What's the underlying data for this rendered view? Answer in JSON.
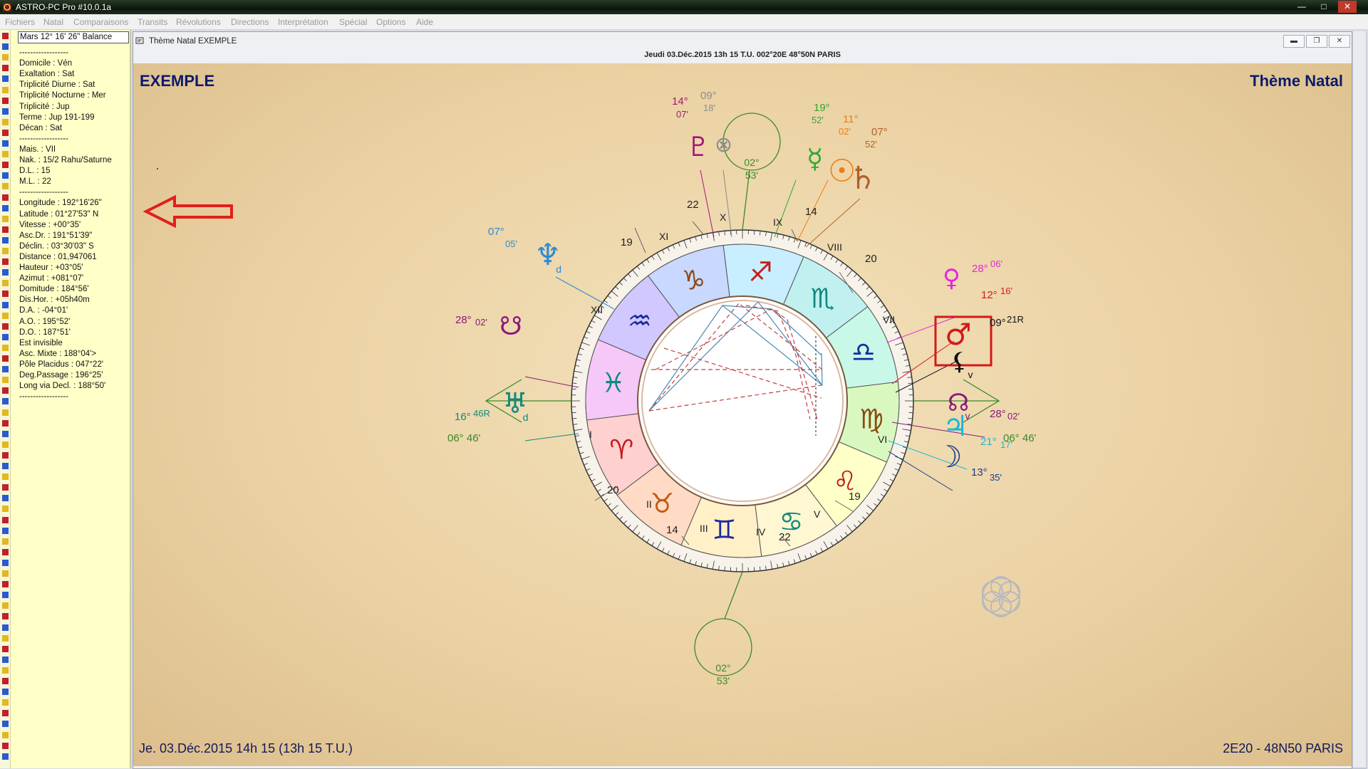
{
  "window": {
    "title": "ASTRO-PC Pro #10.0.1a"
  },
  "menu": [
    "Fichiers",
    "Natal",
    "Comparaisons",
    "Transits",
    "Révolutions",
    "Directions",
    "Interprétation",
    "Spécial",
    "Options",
    "Aide"
  ],
  "left_panel": {
    "headline": "Mars 12° 16' 26\" Balance",
    "lines": [
      "------------------",
      "Domicile : Vén",
      "Exaltation : Sat",
      "Triplicité Diurne : Sat",
      "Triplicité Nocturne : Mer",
      "Triplicité : Jup",
      "Terme : Jup 191-199",
      "Décan : Sat",
      "------------------",
      "Mais. : VII",
      "Nak. : 15/2  Rahu/Saturne",
      "D.L. : 15",
      "M.L. : 22",
      "------------------",
      "Longitude : 192°16'26\"",
      "Latitude : 01°27'53\" N",
      "Vitesse : +00°35'",
      "Asc.Dr. : 191°51'39\"",
      "Déclin. : 03°30'03\" S",
      "Distance : 01,947061",
      "Hauteur : +03°05'",
      "Azimut : +081°07'",
      "Domitude : 184°56'",
      "Dis.Hor. : +05h40m",
      "D.A. : -04°01'",
      "A.O. : 195°52'",
      "D.O. : 187°51'",
      "Est invisible",
      "Asc. Mixte : 188°04'>",
      "Pôle Placidus : 047°22'",
      "Deg.Passage : 196°25'",
      "Long via Decl. : 188°50'",
      "------------------"
    ]
  },
  "child_window": {
    "title": "Thème Natal  EXEMPLE",
    "info": "Jeudi 03.Déc.2015 13h 15 T.U. 002°20E 48°50N  PARIS",
    "buttons": [
      "minimize",
      "restore",
      "close"
    ]
  },
  "chart": {
    "name": "EXEMPLE",
    "kind": "Thème Natal",
    "footer_left": "Je. 03.Déc.2015 14h 15 (13h 15 T.U.)",
    "footer_right": "2E20 - 48N50  PARIS",
    "houses": [
      "I",
      "II",
      "III",
      "IV",
      "V",
      "VI",
      "VII",
      "VIII",
      "IX",
      "X",
      "XI",
      "XII"
    ],
    "signs": [
      {
        "glyph": "♈",
        "color": "#c41a1a",
        "bg": "#ffd0d0"
      },
      {
        "glyph": "♉",
        "color": "#c35a12",
        "bg": "#ffdac4"
      },
      {
        "glyph": "♊",
        "color": "#1a2a9c",
        "bg": "#fff0c8"
      },
      {
        "glyph": "♋",
        "color": "#0e8a7e",
        "bg": "#fff6d2"
      },
      {
        "glyph": "♌",
        "color": "#c41a1a",
        "bg": "#ffffc8"
      },
      {
        "glyph": "♍",
        "color": "#8a4a12",
        "bg": "#d8f8c0"
      },
      {
        "glyph": "♎",
        "color": "#1a2a9c",
        "bg": "#c8f8e8"
      },
      {
        "glyph": "♏",
        "color": "#0e8a7e",
        "bg": "#c0f0f0"
      },
      {
        "glyph": "♐",
        "color": "#c41a1a",
        "bg": "#c8eeff"
      },
      {
        "glyph": "♑",
        "color": "#8a4a12",
        "bg": "#c8d8ff"
      },
      {
        "glyph": "♒",
        "color": "#1a2a9c",
        "bg": "#d0c8ff"
      },
      {
        "glyph": "♓",
        "color": "#0e8a7e",
        "bg": "#f6c8f8"
      }
    ],
    "cusp_degrees": [
      "20",
      "14",
      "22",
      "19",
      "20",
      "14",
      "22",
      "19"
    ],
    "angles": {
      "asc": "06° 46'",
      "dsc": "06° 46'",
      "mc": "02° 53'",
      "ic": "02° 53'"
    },
    "planets": [
      {
        "name": "pluton",
        "glyph": "♇",
        "deg": "14°",
        "min": "07'",
        "color": "#a3177a"
      },
      {
        "name": "fortune",
        "glyph": "⊗",
        "deg": "09°",
        "min": "18'",
        "color": "#8c8c8c"
      },
      {
        "name": "mercure",
        "glyph": "☿",
        "deg": "19°",
        "min": "52'",
        "color": "#33a833"
      },
      {
        "name": "soleil",
        "glyph": "☉",
        "deg": "11°",
        "min": "02'",
        "color": "#f07d10"
      },
      {
        "name": "saturne",
        "glyph": "♄",
        "deg": "07°",
        "min": "52'",
        "color": "#b0602a"
      },
      {
        "name": "neptune",
        "glyph": "♆",
        "deg": "07°",
        "min": "05'",
        "color": "#2c8ad6",
        "flag": "d"
      },
      {
        "name": "venus",
        "glyph": "♀",
        "deg": "28°",
        "min": "06'",
        "color": "#e626d8"
      },
      {
        "name": "mars",
        "glyph": "♂",
        "deg": "12°",
        "min": "16'",
        "color": "#d11a1a"
      },
      {
        "name": "lilith",
        "glyph": "⚸",
        "deg": "09°",
        "min": "21R",
        "color": "#111111",
        "flag": "v"
      },
      {
        "name": "noeud-sud",
        "glyph": "☋",
        "deg": "28°",
        "min": "02'",
        "color": "#8a1a7a"
      },
      {
        "name": "noeud-nord",
        "glyph": "☊",
        "deg": "28°",
        "min": "02'",
        "color": "#8a1a7a",
        "flag": "v"
      },
      {
        "name": "uranus",
        "glyph": "♅",
        "deg": "16°",
        "min": "46R",
        "color": "#0e8a7e",
        "flag": "d"
      },
      {
        "name": "jupiter",
        "glyph": "♃",
        "deg": "21°",
        "min": "17'",
        "color": "#1ab8d6"
      },
      {
        "name": "lune",
        "glyph": "☽",
        "deg": "13°",
        "min": "35'",
        "color": "#1a3a8c"
      }
    ]
  },
  "colors": {
    "accent": "#0d1a6a",
    "panel": "#ffffc8",
    "arrow": "#e0201a",
    "highlight": "#d11a1a"
  }
}
